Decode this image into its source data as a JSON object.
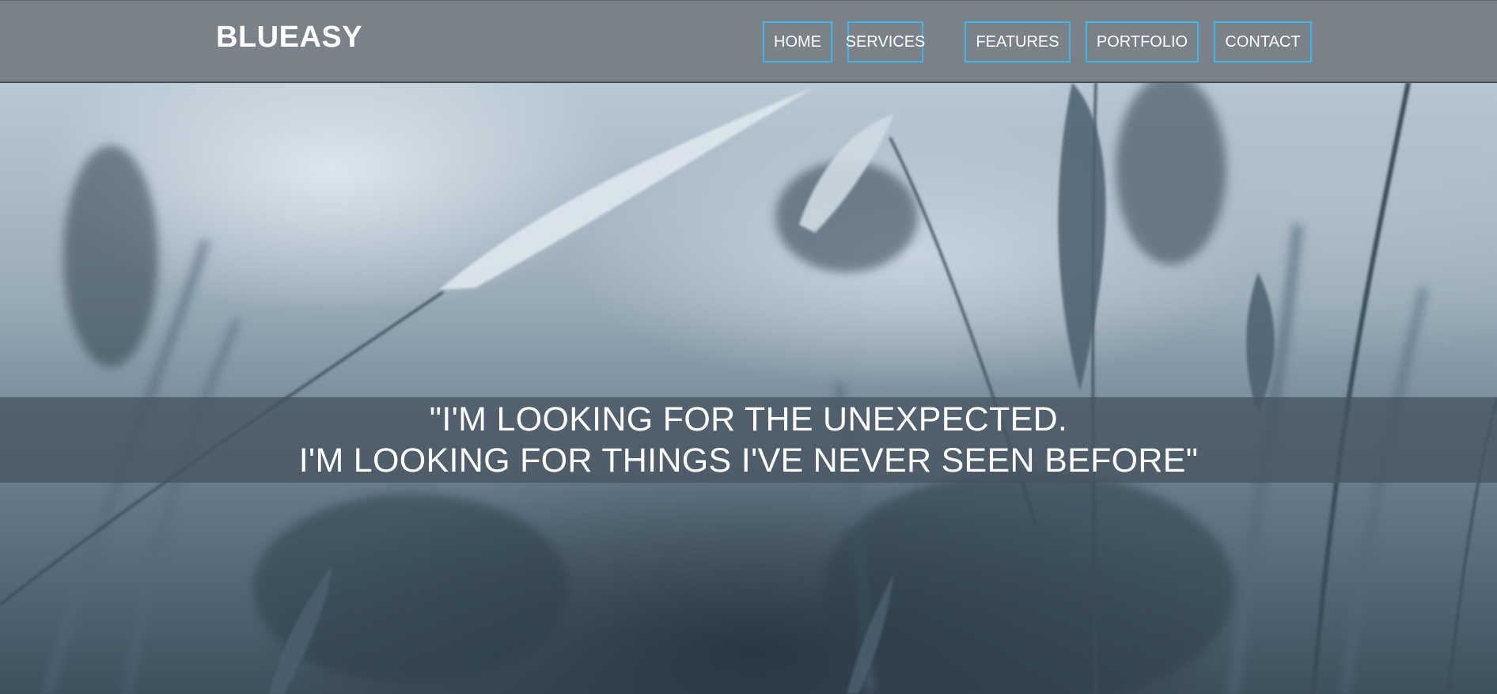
{
  "header": {
    "brand": "BLUEASY",
    "nav": [
      {
        "label": "HOME"
      },
      {
        "label": "SERVICES"
      },
      {
        "label": "FEATURES"
      },
      {
        "label": "PORTFOLIO"
      },
      {
        "label": "CONTACT"
      }
    ]
  },
  "hero": {
    "quote_line1": "\"I'M LOOKING FOR THE UNEXPECTED.",
    "quote_line2": "I'M LOOKING FOR THINGS I'VE NEVER SEEN BEFORE\""
  },
  "colors": {
    "header_bg": "#7b8188",
    "nav_border": "#3fb6e6",
    "quote_band": "#465460"
  }
}
